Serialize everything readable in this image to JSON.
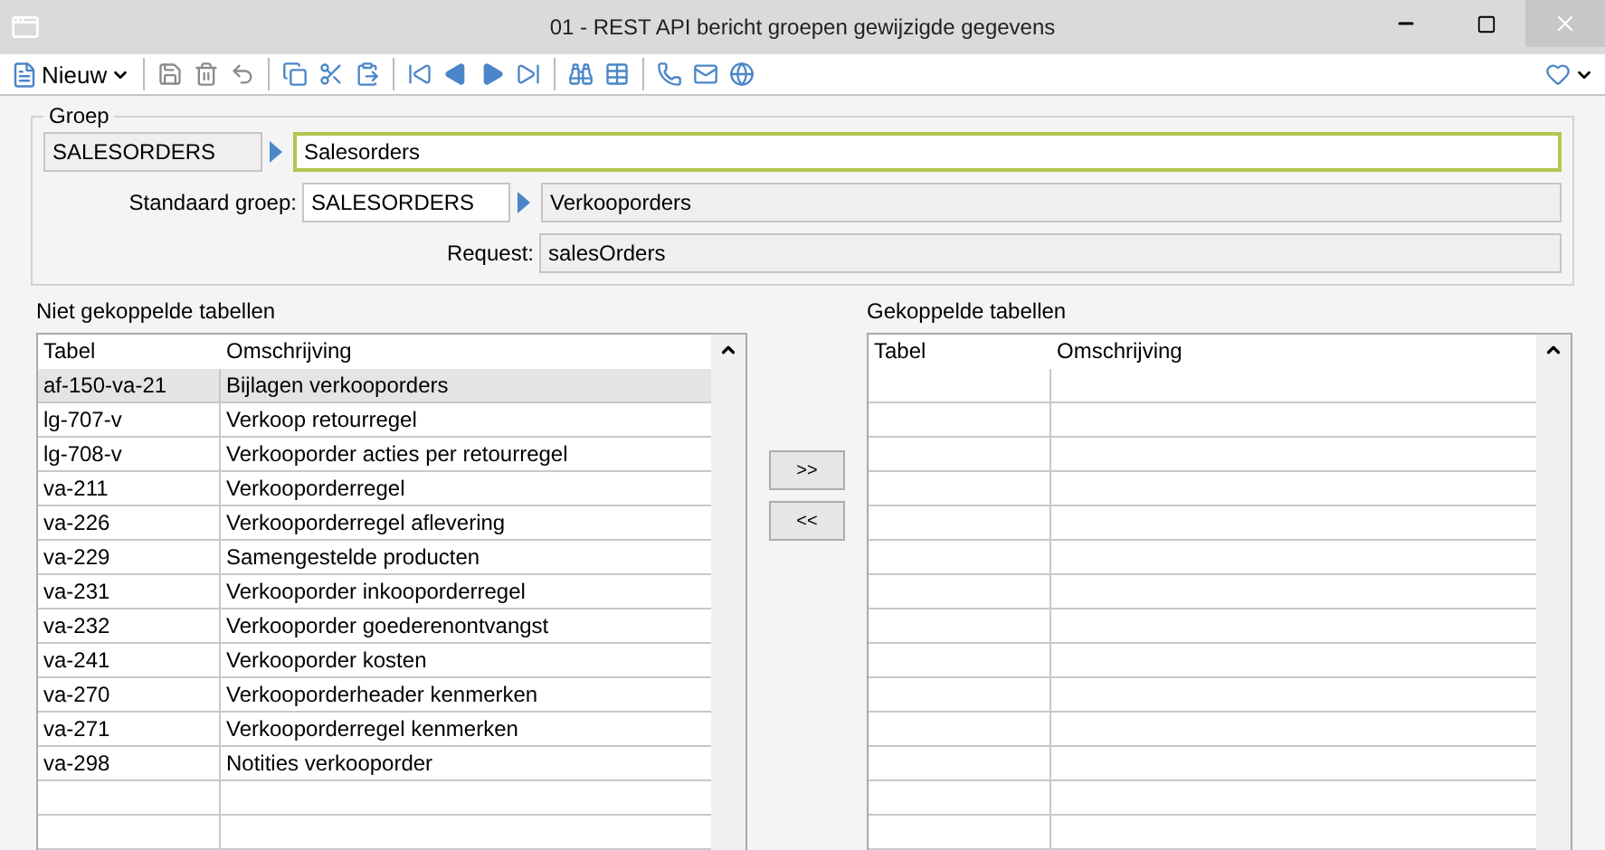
{
  "window": {
    "title": "01 - REST API bericht groepen gewijzigde gegevens"
  },
  "toolbar": {
    "new_label": "Nieuw"
  },
  "group": {
    "legend": "Groep",
    "code": "SALESORDERS",
    "name": "Salesorders",
    "standard_label": "Standaard groep:",
    "standard_code": "SALESORDERS",
    "standard_name": "Verkooporders",
    "request_label": "Request:",
    "request_value": "salesOrders"
  },
  "unlinked": {
    "title": "Niet gekoppelde tabellen",
    "columns": [
      "Tabel",
      "Omschrijving"
    ],
    "rows": [
      {
        "table": "af-150-va-21",
        "description": "Bijlagen verkooporders",
        "selected": true
      },
      {
        "table": "lg-707-v",
        "description": "Verkoop retourregel",
        "selected": false
      },
      {
        "table": "lg-708-v",
        "description": "Verkooporder acties per retourregel",
        "selected": false
      },
      {
        "table": "va-211",
        "description": "Verkooporderregel",
        "selected": false
      },
      {
        "table": "va-226",
        "description": "Verkooporderregel aflevering",
        "selected": false
      },
      {
        "table": "va-229",
        "description": "Samengestelde producten",
        "selected": false
      },
      {
        "table": "va-231",
        "description": "Verkooporder inkooporderregel",
        "selected": false
      },
      {
        "table": "va-232",
        "description": "Verkooporder goederenontvangst",
        "selected": false
      },
      {
        "table": "va-241",
        "description": "Verkooporder kosten",
        "selected": false
      },
      {
        "table": "va-270",
        "description": "Verkooporderheader kenmerken",
        "selected": false
      },
      {
        "table": "va-271",
        "description": "Verkooporderregel kenmerken",
        "selected": false
      },
      {
        "table": "va-298",
        "description": "Notities verkooporder",
        "selected": false
      }
    ]
  },
  "transfer_buttons": [
    ">>",
    "<<"
  ],
  "linked": {
    "title": "Gekoppelde tabellen",
    "columns": [
      "Tabel",
      "Omschrijving"
    ]
  }
}
